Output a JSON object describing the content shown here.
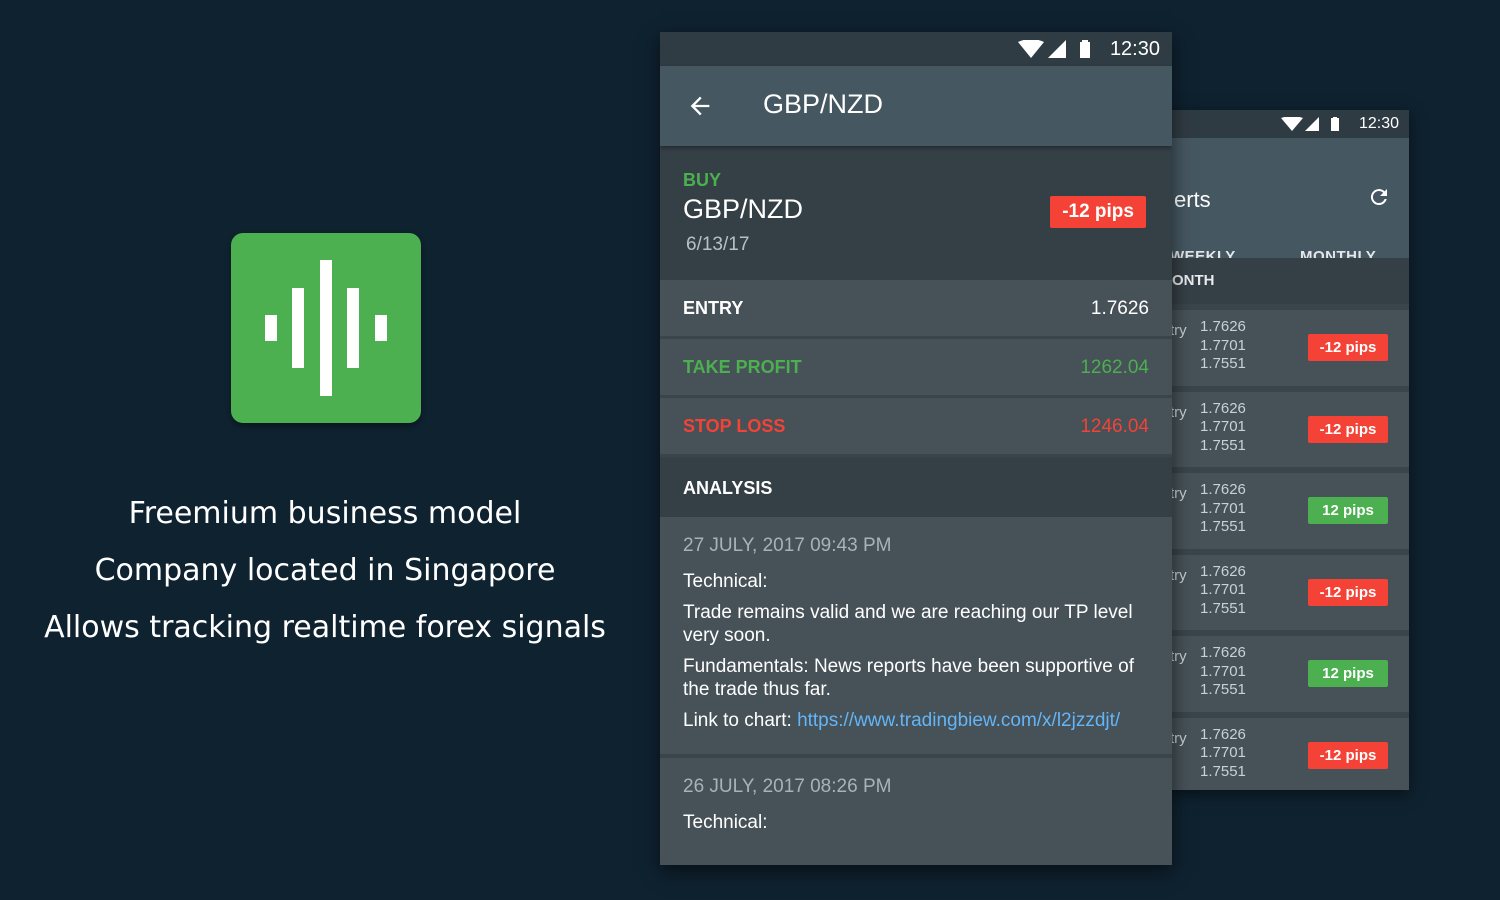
{
  "promo": {
    "lines": [
      "Freemium business model",
      "Company located in Singapore",
      "Allows tracking realtime forex signals"
    ]
  },
  "back_phone": {
    "status_time": "12:30",
    "title_partial": "erts",
    "tabs": [
      "WEEKLY",
      "MONTHLY"
    ],
    "section": "ONTH",
    "rows": [
      {
        "label": "try",
        "values": [
          "1.7626",
          "1.7701",
          "1.7551"
        ],
        "pips": "-12 pips",
        "positive": false
      },
      {
        "label": "try",
        "values": [
          "1.7626",
          "1.7701",
          "1.7551"
        ],
        "pips": "-12 pips",
        "positive": false
      },
      {
        "label": "try",
        "values": [
          "1.7626",
          "1.7701",
          "1.7551"
        ],
        "pips": "12 pips",
        "positive": true
      },
      {
        "label": "try",
        "values": [
          "1.7626",
          "1.7701",
          "1.7551"
        ],
        "pips": "-12 pips",
        "positive": false
      },
      {
        "label": "try",
        "values": [
          "1.7626",
          "1.7701",
          "1.7551"
        ],
        "pips": "12 pips",
        "positive": true
      },
      {
        "label": "try",
        "values": [
          "1.7626",
          "1.7701",
          "1.7551"
        ],
        "pips": "-12 pips",
        "positive": false
      }
    ]
  },
  "front_phone": {
    "status_time": "12:30",
    "title": "GBP/NZD",
    "signal": {
      "side": "BUY",
      "pair": "GBP/NZD",
      "date": "6/13/17",
      "pips": "-12 pips"
    },
    "entry": {
      "label": "ENTRY",
      "value": "1.7626"
    },
    "take_profit": {
      "label": "TAKE PROFIT",
      "value": "1262.04"
    },
    "stop_loss": {
      "label": "STOP LOSS",
      "value": "1246.04"
    },
    "analysis_header": "ANALYSIS",
    "analyses": [
      {
        "datetime": "27 JULY, 2017 09:43 PM",
        "technical_label": "Technical:",
        "technical_text": "Trade remains valid and we are reaching our TP level very soon.",
        "fundamentals_text": "Fundamentals: News reports have been supportive of the trade thus far.",
        "link_prefix": "Link to chart: ",
        "link": "https://www.tradingbiew.com/x/l2jzzdjt/"
      },
      {
        "datetime": "26 JULY, 2017 08:26 PM",
        "technical_label": "Technical:"
      }
    ]
  },
  "colors": {
    "background": "#0f2230",
    "green": "#4caf50",
    "red": "#f44336",
    "link": "#64b5f6"
  }
}
